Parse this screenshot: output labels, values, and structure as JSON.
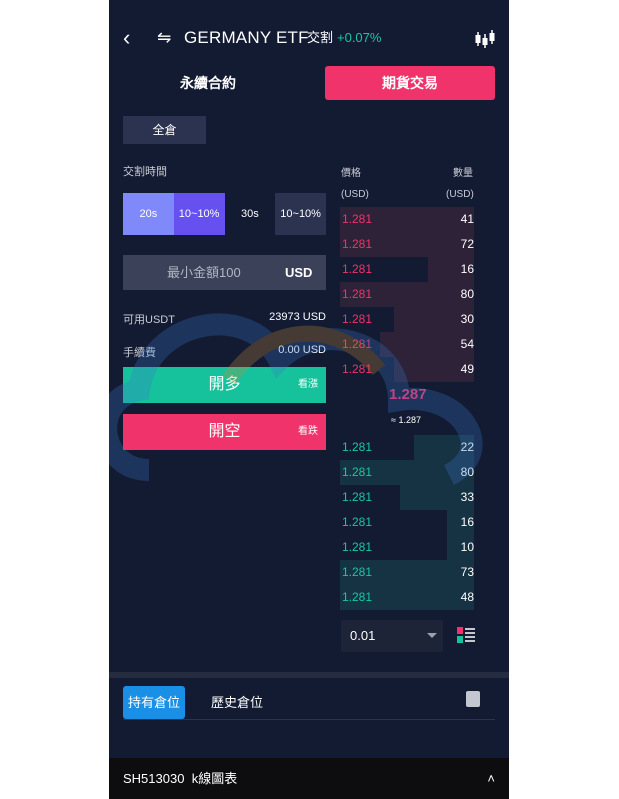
{
  "header": {
    "back_icon": "chevron-left-icon",
    "swap_icon": "swap-icon",
    "title": "GERMANY ETF",
    "subtitle": "交割",
    "change": "+0.07%",
    "chart_icon": "candlestick-icon"
  },
  "mode_tabs": {
    "perpetual": "永續合約",
    "futures": "期貨交易"
  },
  "margin_mode": "全倉",
  "settlement": {
    "label": "交割時間",
    "options": [
      {
        "label": "20s"
      },
      {
        "label": "10~10%"
      },
      {
        "label": "30s"
      },
      {
        "label": "10~10%"
      }
    ]
  },
  "amount_input": {
    "placeholder": "最小金額100",
    "unit": "USD"
  },
  "balance": {
    "available_label": "可用USDT",
    "available_value": "23973 USD",
    "fee_label": "手續費",
    "fee_value": "0.00 USD"
  },
  "actions": {
    "long_label": "開多",
    "long_hint": "看漲",
    "short_label": "開空",
    "short_hint": "看跌"
  },
  "orderbook": {
    "price_header": "價格",
    "qty_header": "數量",
    "price_unit": "(USD)",
    "qty_unit": "(USD)",
    "asks": [
      {
        "price": "1.281",
        "qty": "41",
        "depth": 1.0
      },
      {
        "price": "1.281",
        "qty": "72",
        "depth": 1.0
      },
      {
        "price": "1.281",
        "qty": "16",
        "depth": 0.34
      },
      {
        "price": "1.281",
        "qty": "80",
        "depth": 1.0
      },
      {
        "price": "1.281",
        "qty": "30",
        "depth": 0.6
      },
      {
        "price": "1.281",
        "qty": "54",
        "depth": 0.7
      },
      {
        "price": "1.281",
        "qty": "49",
        "depth": 0.6
      }
    ],
    "last_price": "1.287",
    "approx_price": "≈ 1.287",
    "bids": [
      {
        "price": "1.281",
        "qty": "22",
        "depth": 0.45
      },
      {
        "price": "1.281",
        "qty": "80",
        "depth": 1.0
      },
      {
        "price": "1.281",
        "qty": "33",
        "depth": 0.55
      },
      {
        "price": "1.281",
        "qty": "16",
        "depth": 0.2
      },
      {
        "price": "1.281",
        "qty": "10",
        "depth": 0.2
      },
      {
        "price": "1.281",
        "qty": "73",
        "depth": 1.0
      },
      {
        "price": "1.281",
        "qty": "48",
        "depth": 1.0
      }
    ],
    "precision": "0.01",
    "layout_icon": "orderbook-layout-icon"
  },
  "positions": {
    "tab_active": "持有倉位",
    "tab_history": "歷史倉位",
    "icon": "document-icon"
  },
  "footer": {
    "symbol": "SH513030",
    "chart_label": "k線圖表",
    "caret": "˄"
  },
  "colors": {
    "bg": "#131b33",
    "red": "#f0336b",
    "green": "#16c29c",
    "blue": "#1990e6",
    "purple": "#6650f0"
  }
}
